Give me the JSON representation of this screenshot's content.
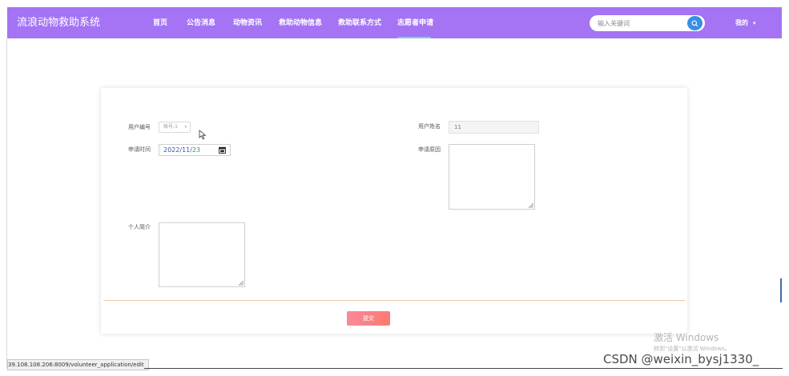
{
  "nav": {
    "brand": "流浪动物救助系统",
    "items": [
      "首页",
      "公告消息",
      "动物资讯",
      "救助动物信息",
      "救助联系方式",
      "志愿者申请"
    ],
    "search_placeholder": "输入关键词",
    "user_menu": "我的"
  },
  "form": {
    "user_id_label": "用户编号",
    "user_id_value": "账号-1",
    "user_name_label": "用户姓名",
    "user_name_value": "11",
    "apply_time_label": "申请时间",
    "apply_time": {
      "year": "2022",
      "sep1": "/",
      "month": "11",
      "sep2": "/",
      "day": "23"
    },
    "apply_reason_label": "申请原因",
    "intro_label": "个人简介",
    "submit_label": "提交"
  },
  "status_bar": {
    "url": "39.108.108.206:8009/volunteer_application/edit"
  },
  "watermark": {
    "title": "激活 Windows",
    "subtitle": "转到\"设置\"以激活 Windows。",
    "csdn": "CSDN @weixin_bysj1330_"
  },
  "colors": {
    "navbar": "#a474f4",
    "submit": "#fc7a72",
    "search_button": "#3a8ee6"
  }
}
